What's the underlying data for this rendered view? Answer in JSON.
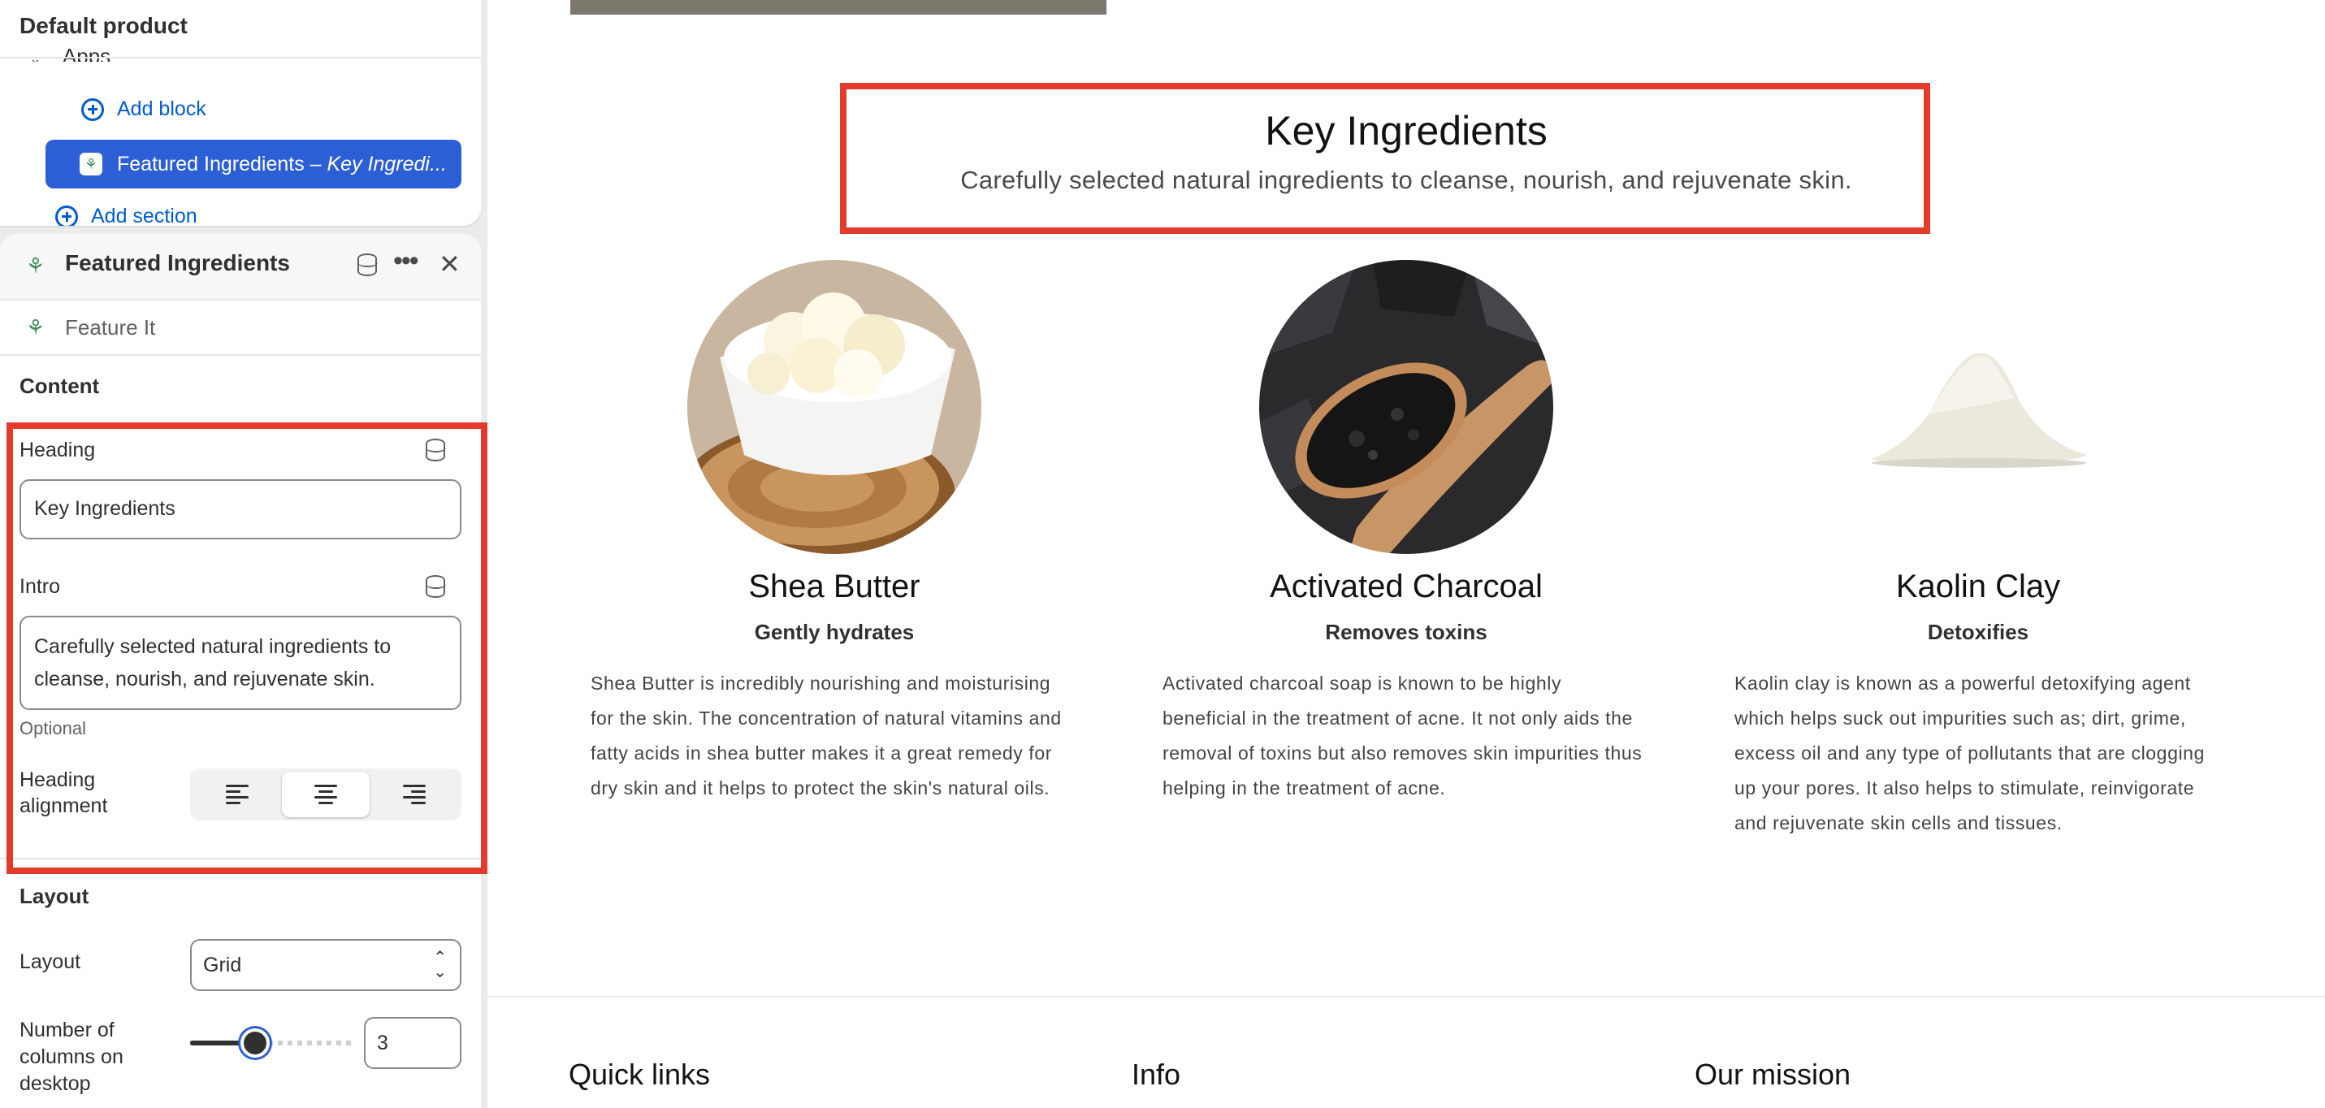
{
  "editor": {
    "tree": {
      "title": "Default product",
      "apps_label": "Apps",
      "add_block": "Add block",
      "selected_item_name": "Featured Ingredients",
      "selected_item_sep": " – ",
      "selected_item_italic": "Key Ingredi...",
      "add_section": "Add section"
    },
    "settings": {
      "title": "Featured Ingredients",
      "app_name": "Feature It",
      "content_heading": "Content",
      "heading_label": "Heading",
      "heading_value": "Key Ingredients",
      "intro_label": "Intro",
      "intro_value_line1": "Carefully selected natural ingredients to",
      "intro_value_line2": "cleanse, nourish, and rejuvenate skin.",
      "optional_hint": "Optional",
      "heading_alignment_label_line1": "Heading",
      "heading_alignment_label_line2": "alignment",
      "alignment_selected": "center",
      "layout_heading": "Layout",
      "layout_label": "Layout",
      "layout_value": "Grid",
      "columns_label_line1": "Number of",
      "columns_label_line2": "columns on",
      "columns_label_line3": "desktop",
      "columns_value": "3",
      "columns_slider_fraction": 0.4
    }
  },
  "preview": {
    "heading": "Key Ingredients",
    "intro": "Carefully selected natural ingredients to cleanse, nourish, and rejuvenate skin.",
    "ingredients": [
      {
        "name": "Shea Butter",
        "subtitle": "Gently hydrates",
        "description": "Shea Butter is incredibly nourishing and moisturising for the skin. The concentration of natural vitamins and fatty acids in shea butter makes it a great remedy for dry skin and it helps to protect the skin's natural oils."
      },
      {
        "name": "Activated Charcoal",
        "subtitle": "Removes toxins",
        "description": "Activated charcoal soap is known to be highly beneficial in the treatment of acne. It not only aids the removal of toxins but also removes skin impurities thus helping in the treatment of acne."
      },
      {
        "name": "Kaolin Clay",
        "subtitle": "Detoxifies",
        "description": "Kaolin clay is known as a powerful detoxifying agent which helps suck out impurities such as; dirt, grime, excess oil and any type of pollutants that are clogging up your pores. It also helps to stimulate, reinvigorate and rejuvenate skin cells and tissues."
      }
    ],
    "footer": {
      "quick_links": "Quick links",
      "info": "Info",
      "our_mission": "Our mission"
    }
  },
  "colors": {
    "accent_blue": "#2c5fd6",
    "highlight_red": "#e33b2b",
    "app_green": "#3f8f5a"
  }
}
